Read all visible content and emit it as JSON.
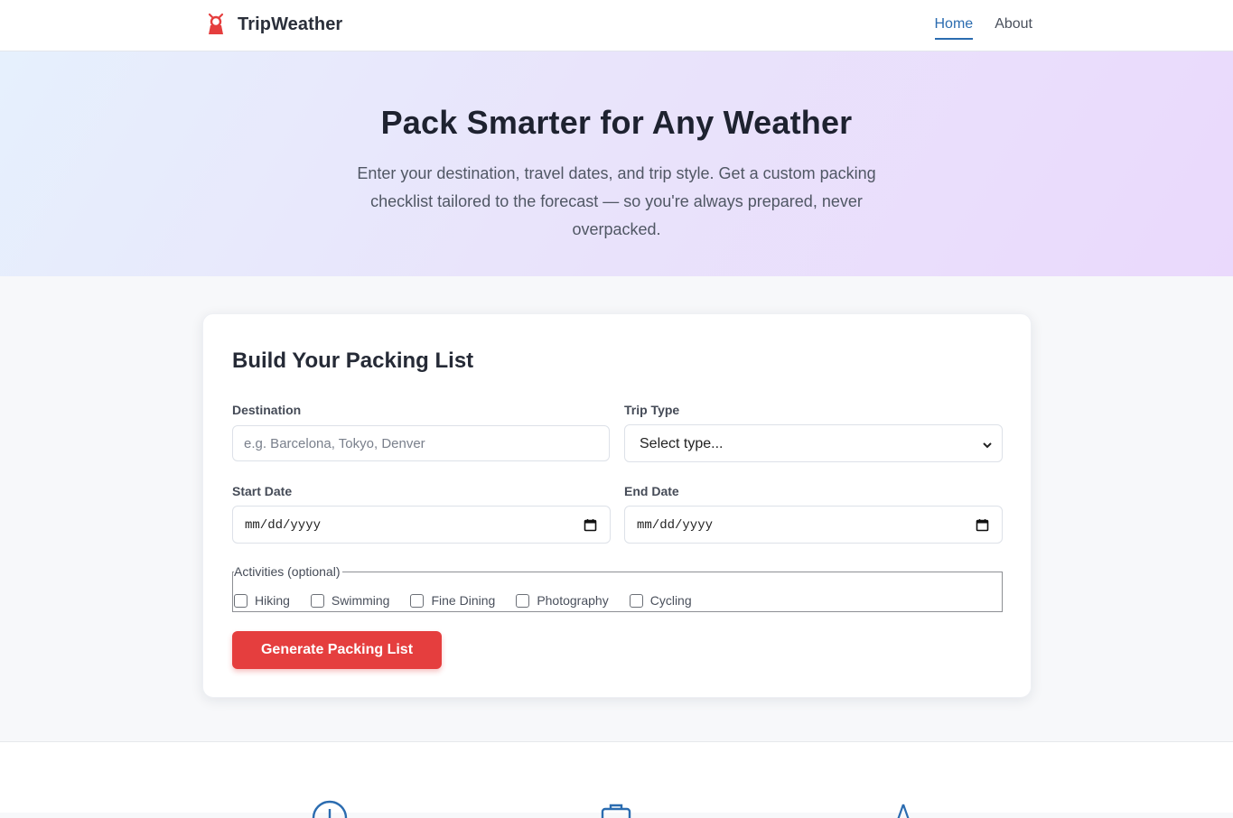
{
  "header": {
    "brand": "TripWeather",
    "nav": [
      {
        "label": "Home",
        "active": true
      },
      {
        "label": "About",
        "active": false
      }
    ]
  },
  "hero": {
    "title": "Pack Smarter for Any Weather",
    "subtitle": "Enter your destination, travel dates, and trip style. Get a custom packing checklist tailored to the forecast — so you're always prepared, never overpacked."
  },
  "form": {
    "title": "Build Your Packing List",
    "destination": {
      "label": "Destination",
      "placeholder": "e.g. Barcelona, Tokyo, Denver",
      "value": ""
    },
    "trip_type": {
      "label": "Trip Type",
      "selected": "Select type..."
    },
    "start_date": {
      "label": "Start Date",
      "value": "mm/dd/yyyy"
    },
    "end_date": {
      "label": "End Date",
      "value": "mm/dd/yyyy"
    },
    "activities": {
      "legend": "Activities (optional)",
      "options": [
        "Hiking",
        "Swimming",
        "Fine Dining",
        "Photography",
        "Cycling"
      ]
    },
    "submit_label": "Generate Packing List"
  },
  "colors": {
    "accent_red": "#e53e3e",
    "nav_active": "#2b6cb0",
    "feature_icon": "#2b6cb0"
  },
  "features": {
    "icons": [
      "clock-icon",
      "suitcase-icon",
      "mountain-icon"
    ]
  }
}
